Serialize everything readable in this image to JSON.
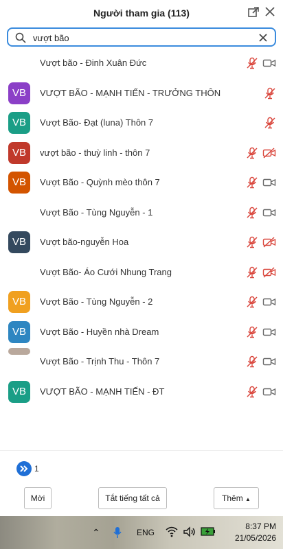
{
  "header": {
    "title": "Người tham gia (113)"
  },
  "search": {
    "value": "vượt bão"
  },
  "participants": [
    {
      "name": "Vượt bão - Đinh Xuân Đức",
      "avatar": "",
      "color": "",
      "mic_muted": true,
      "video": "on"
    },
    {
      "name": "VƯỢT BÃO - MẠNH TIẾN - TRƯỞNG THÔN",
      "avatar": "VB",
      "color": "#8b3fc7",
      "mic_muted": true,
      "video": "none"
    },
    {
      "name": "Vượt Bão- Đạt (luna) Thôn 7",
      "avatar": "VB",
      "color": "#1a9e86",
      "mic_muted": true,
      "video": "none"
    },
    {
      "name": "vượt bão - thuỳ linh - thôn 7",
      "avatar": "VB",
      "color": "#c0392b",
      "mic_muted": true,
      "video": "off"
    },
    {
      "name": "Vượt Bão - Quỳnh mèo thôn 7",
      "avatar": "VB",
      "color": "#d35400",
      "mic_muted": true,
      "video": "on"
    },
    {
      "name": "Vượt Bão - Tùng Nguyễn - 1",
      "avatar": "",
      "color": "",
      "mic_muted": true,
      "video": "on"
    },
    {
      "name": "Vượt bão-nguyễn Hoa",
      "avatar": "VB",
      "color": "#34495e",
      "mic_muted": true,
      "video": "off"
    },
    {
      "name": "Vượt Bão- Áo Cưới Nhung Trang",
      "avatar": "",
      "color": "",
      "mic_muted": true,
      "video": "off"
    },
    {
      "name": "Vượt Bão - Tùng Nguyễn - 2",
      "avatar": "VB",
      "color": "#f0a020",
      "mic_muted": true,
      "video": "on"
    },
    {
      "name": "Vượt Bão - Huyền nhà Dream",
      "avatar": "VB",
      "color": "#2e86c1",
      "mic_muted": true,
      "video": "on"
    },
    {
      "name": "Vượt Bão - Trịnh Thu - Thôn 7",
      "avatar": "",
      "color": "#b9a89c",
      "mic_muted": true,
      "video": "on"
    },
    {
      "name": "VƯỢT BÃO - MẠNH TIẾN - ĐT",
      "avatar": "VB",
      "color": "#1a9e86",
      "mic_muted": true,
      "video": "on"
    }
  ],
  "pagination": {
    "page": "1"
  },
  "footer": {
    "invite": "Mời",
    "mute_all": "Tắt tiếng tất cả",
    "more": "Thêm"
  },
  "taskbar": {
    "lang": "ENG",
    "time": "8:37 PM",
    "date": "21/05/2026"
  },
  "colors": {
    "accent": "#1f6fd6",
    "muted_red": "#d9453b",
    "icon_gray": "#666666"
  }
}
